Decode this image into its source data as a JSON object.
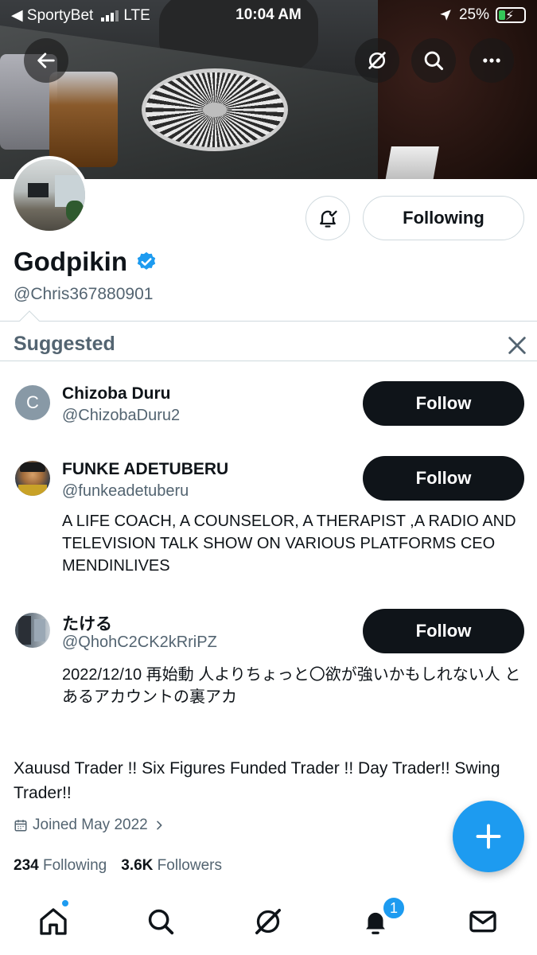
{
  "status_bar": {
    "carrier": "◀ SportyBet",
    "network": "LTE",
    "time": "10:04 AM",
    "battery": "25%",
    "battery_level": 0.25
  },
  "header": {
    "back_icon": "arrow-left-icon",
    "grok_icon": "grok-icon",
    "search_icon": "search-icon",
    "more_icon": "more-icon"
  },
  "profile": {
    "name": "Godpikin",
    "handle": "@Chris367880901",
    "verified": true,
    "following_button": "Following",
    "bio": "Xauusd Trader !! Six Figures Funded Trader !! Day Trader!! Swing Trader!!",
    "joined": "Joined May 2022",
    "following_count": "234",
    "following_label": "Following",
    "followers_count": "3.6K",
    "followers_label": "Followers"
  },
  "suggested": {
    "title": "Suggested",
    "items": [
      {
        "name": "Chizoba Duru",
        "handle": "@ChizobaDuru2",
        "initial": "C",
        "button": "Follow",
        "bio": ""
      },
      {
        "name": "FUNKE ADETUBERU",
        "handle": "@funkeadetuberu",
        "button": "Follow",
        "bio": "A LIFE COACH, A COUNSELOR, A THERAPIST ,A RADIO AND TELEVISION TALK SHOW ON VARIOUS PLATFORMS CEO MENDINLIVES"
      },
      {
        "name": "たける",
        "handle": "@QhohC2CK2kRriPZ",
        "button": "Follow",
        "bio": "2022/12/10 再始動 人よりちょっと〇欲が強いかもしれない人 とあるアカウントの裏アカ"
      }
    ]
  },
  "tabbar": {
    "notification_count": "1"
  },
  "colors": {
    "accent": "#1d9bf0",
    "text": "#0f1419",
    "secondary_text": "#536471"
  }
}
